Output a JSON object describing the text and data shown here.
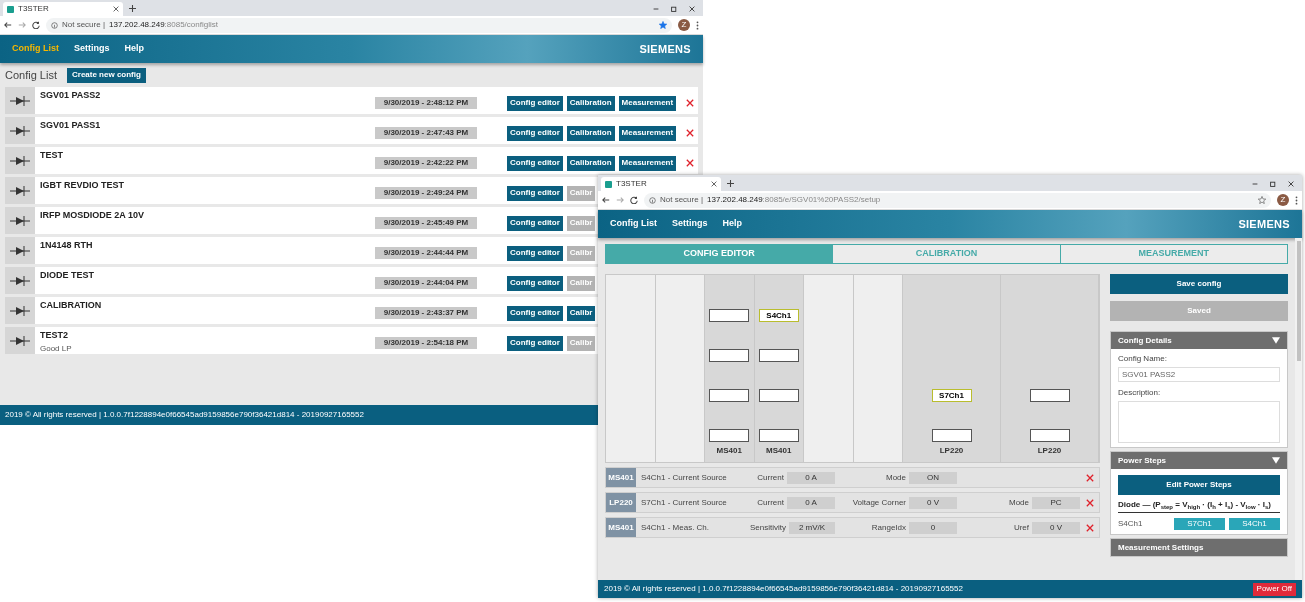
{
  "back_window": {
    "tab_title": "T3STER",
    "security_label": "Not secure |",
    "url_host": "137.202.48.249",
    "url_path": ":8085/configlist",
    "avatar": "Z",
    "bookmarked": true,
    "nav": [
      {
        "label": "Config List",
        "selected": true
      },
      {
        "label": "Settings",
        "selected": false
      },
      {
        "label": "Help",
        "selected": false
      }
    ],
    "brand": "SIEMENS",
    "page_title": "Config List",
    "create_button": "Create new config",
    "configs": [
      {
        "name": "SGV01 PASS2",
        "date": "9/30/2019 - 2:48:12 PM",
        "buttons": [
          {
            "label": "Config editor",
            "disabled": false
          },
          {
            "label": "Calibration",
            "disabled": false
          },
          {
            "label": "Measurement",
            "disabled": false
          }
        ],
        "deletable": true
      },
      {
        "name": "SGV01 PASS1",
        "date": "9/30/2019 - 2:47:43 PM",
        "buttons": [
          {
            "label": "Config editor",
            "disabled": false
          },
          {
            "label": "Calibration",
            "disabled": false
          },
          {
            "label": "Measurement",
            "disabled": false
          }
        ],
        "deletable": true
      },
      {
        "name": "TEST",
        "date": "9/30/2019 - 2:42:22 PM",
        "buttons": [
          {
            "label": "Config editor",
            "disabled": false
          },
          {
            "label": "Calibration",
            "disabled": false
          },
          {
            "label": "Measurement",
            "disabled": false
          }
        ],
        "deletable": true
      },
      {
        "name": "IGBT REVDIO TEST",
        "date": "9/30/2019 - 2:49:24 PM",
        "buttons": [
          {
            "label": "Config editor",
            "disabled": false
          },
          {
            "label": "Calibr",
            "disabled": true
          }
        ],
        "deletable": false
      },
      {
        "name": "IRFP MOSDIODE 2A 10V",
        "date": "9/30/2019 - 2:45:49 PM",
        "buttons": [
          {
            "label": "Config editor",
            "disabled": false
          },
          {
            "label": "Calibr",
            "disabled": true
          }
        ],
        "deletable": false
      },
      {
        "name": "1N4148 RTH",
        "date": "9/30/2019 - 2:44:44 PM",
        "buttons": [
          {
            "label": "Config editor",
            "disabled": false
          },
          {
            "label": "Calibr",
            "disabled": true
          }
        ],
        "deletable": false
      },
      {
        "name": "DIODE TEST",
        "date": "9/30/2019 - 2:44:04 PM",
        "buttons": [
          {
            "label": "Config editor",
            "disabled": false
          },
          {
            "label": "Calibr",
            "disabled": true
          }
        ],
        "deletable": false
      },
      {
        "name": "CALIBRATION",
        "date": "9/30/2019 - 2:43:37 PM",
        "buttons": [
          {
            "label": "Config editor",
            "disabled": false
          },
          {
            "label": "Calibr",
            "disabled": false
          }
        ],
        "deletable": false
      },
      {
        "name": "TEST2",
        "description": "Good LP",
        "date": "9/30/2019 - 2:54:18 PM",
        "buttons": [
          {
            "label": "Config editor",
            "disabled": false
          },
          {
            "label": "Calibr",
            "disabled": true
          }
        ],
        "deletable": false
      }
    ],
    "footer": "2019 © All rights reserved | 1.0.0.7f1228894e0f66545ad9159856e790f36421d814 - 20190927165552"
  },
  "front_window": {
    "tab_title": "T3STER",
    "security_label": "Not secure |",
    "url_host": "137.202.48.249",
    "url_path": ":8085/e/SGV01%20PASS2/setup",
    "avatar": "Z",
    "bookmarked": false,
    "nav": [
      {
        "label": "Config List",
        "selected": false
      },
      {
        "label": "Settings",
        "selected": false
      },
      {
        "label": "Help",
        "selected": false
      }
    ],
    "brand": "SIEMENS",
    "tabs": [
      {
        "label": "CONFIG EDITOR",
        "selected": true
      },
      {
        "label": "CALIBRATION",
        "selected": false
      },
      {
        "label": "MEASUREMENT",
        "selected": false
      }
    ],
    "rack": [
      {
        "wide": false
      },
      {
        "wide": false
      },
      {
        "wide": false,
        "card": "MS401",
        "slots": [
          {
            "assigned": false
          },
          {
            "assigned": false
          },
          {
            "assigned": false
          },
          {
            "assigned": false
          }
        ]
      },
      {
        "wide": false,
        "card": "MS401",
        "slots": [
          {
            "label": "S4Ch1",
            "assigned": true
          },
          {
            "assigned": false
          },
          {
            "assigned": false
          },
          {
            "assigned": false
          }
        ]
      },
      {
        "wide": false
      },
      {
        "wide": false
      },
      {
        "wide": true,
        "card": "LP220",
        "slots": [
          {
            "label": "S7Ch1",
            "assigned": true
          },
          {
            "assigned": false
          }
        ]
      },
      {
        "wide": true,
        "card": "LP220",
        "slots": [
          {
            "assigned": false
          },
          {
            "assigned": false
          }
        ]
      }
    ],
    "channels": [
      {
        "module": "MS401",
        "title": "S4Ch1 - Current Source",
        "fields": [
          {
            "label": "Current",
            "value": "0 A"
          },
          {
            "label": "Mode",
            "value": "ON"
          }
        ]
      },
      {
        "module": "LP220",
        "title": "S7Ch1 - Current Source",
        "fields": [
          {
            "label": "Current",
            "value": "0 A"
          },
          {
            "label": "Voltage Corner",
            "value": "0 V"
          },
          {
            "label": "Mode",
            "value": "PC"
          }
        ]
      },
      {
        "module": "MS401",
        "title": "S4Ch1 - Meas. Ch.",
        "fields": [
          {
            "label": "Sensitivity",
            "value": "2 mV/K"
          },
          {
            "label": "RangeIdx",
            "value": "0"
          },
          {
            "label": "Uref",
            "value": "0 V"
          }
        ]
      }
    ],
    "save_button": {
      "label": "Save config",
      "disabled": false
    },
    "saved_button": {
      "label": "Saved",
      "disabled": true
    },
    "config_details": {
      "title": "Config Details",
      "expanded": true,
      "name_label": "Config Name:",
      "name_value": "SGV01 PASS2",
      "description_label": "Description:"
    },
    "power_steps": {
      "title": "Power Steps",
      "expanded": true,
      "edit_button": "Edit Power Steps",
      "formula": "Diode — (P$_{step}$ = V$_{high}$ · (I$_{h}$ + I$_{s}$) - V$_{low}$ · I$_{s}$)",
      "channel_label": "S4Ch1",
      "channel_buttons": [
        "S7Ch1",
        "S4Ch1"
      ]
    },
    "measurement_settings": {
      "title": "Measurement Settings"
    },
    "footer": "2019 © All rights reserved | 1.0.0.7f1228894e0f66545ad9159856e790f36421d814 - 20190927165552",
    "power_button": "Power Off"
  }
}
